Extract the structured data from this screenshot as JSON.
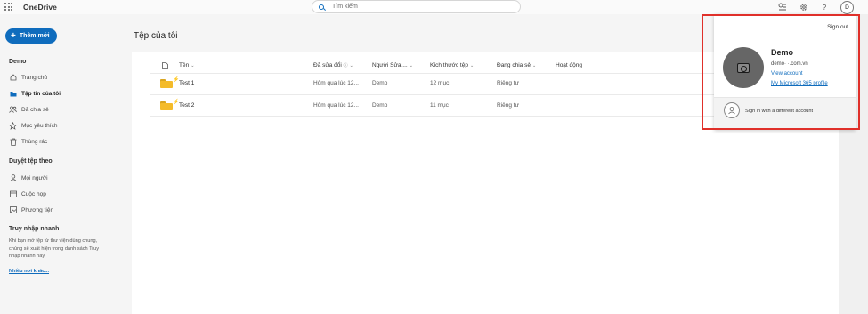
{
  "app": {
    "brand": "OneDrive"
  },
  "search": {
    "placeholder": "Tìm kiếm"
  },
  "topbar_icons": [
    "waffle-icon",
    "rewards-icon",
    "settings-icon",
    "help-icon"
  ],
  "user": {
    "initial": "D"
  },
  "sidebar": {
    "new_button": "Thêm mới",
    "account_heading": "Demo",
    "items": [
      {
        "label": "Trang chủ",
        "icon": "home-icon"
      },
      {
        "label": "Tập tin của tôi",
        "icon": "folder-icon",
        "active": true
      },
      {
        "label": "Đã chia sẻ",
        "icon": "people-icon"
      },
      {
        "label": "Mục yêu thích",
        "icon": "star-icon"
      },
      {
        "label": "Thùng rác",
        "icon": "trash-icon"
      }
    ],
    "browse_heading": "Duyệt tệp theo",
    "browse_items": [
      {
        "label": "Mọi người",
        "icon": "person-icon"
      },
      {
        "label": "Cuộc họp",
        "icon": "calendar-icon"
      },
      {
        "label": "Phương tiện",
        "icon": "image-icon"
      }
    ],
    "quick_heading": "Truy nhập nhanh",
    "quick_text": "Khi bạn mở tệp từ thư viện dùng chung, chúng sẽ xuất hiện trong danh sách Truy nhập nhanh này.",
    "quick_link": "Nhiều nơi khác..."
  },
  "main": {
    "title": "Tệp của tôi",
    "columns": [
      "Tên",
      "Đã sửa đổi",
      "Người Sửa ...",
      "Kích thước tệp",
      "Đang chia sẻ",
      "Hoạt động"
    ],
    "rows": [
      {
        "name": "Test 1",
        "modified": "Hôm qua lúc 12...",
        "modified_by": "Demo",
        "size": "12 mục",
        "sharing": "Riêng tư"
      },
      {
        "name": "Test 2",
        "modified": "Hôm qua lúc 12...",
        "modified_by": "Demo",
        "size": "11 mục",
        "sharing": "Riêng tư"
      }
    ]
  },
  "account_popup": {
    "sign_out": "Sign out",
    "name": "Demo",
    "email": "demo·        ·.com.vn",
    "view_account": "View account",
    "profile_link": "My Microsoft 365 profile",
    "other_account": "Sign in with a different account",
    "highlight_color": "#e0302a"
  },
  "colors": {
    "accent": "#0f6cbd",
    "folder": "#f4bb2a"
  }
}
